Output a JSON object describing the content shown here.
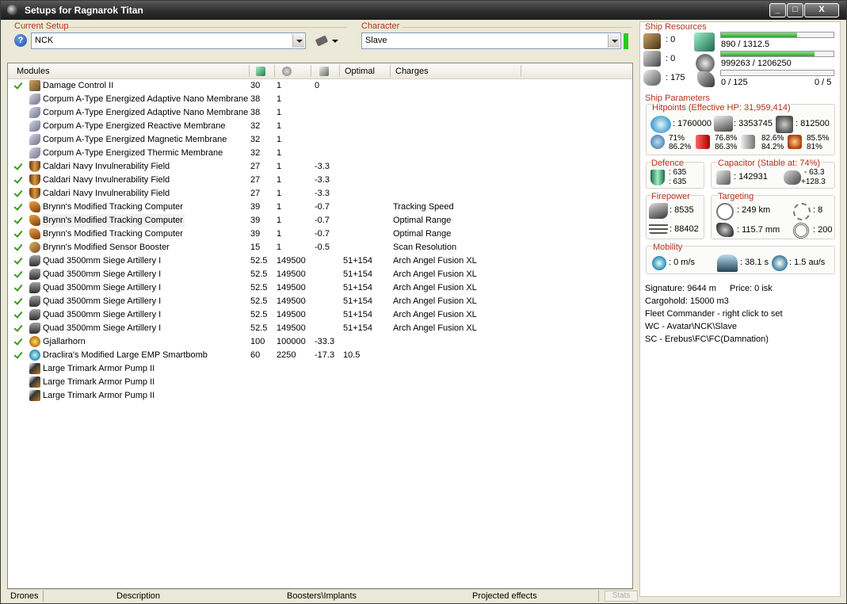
{
  "window": {
    "title": "Setups for Ragnarok Titan",
    "min_label": "_",
    "max_label": "□",
    "close_label": "X"
  },
  "setup": {
    "label": "Current Setup",
    "value": "NCK",
    "help_label": "?"
  },
  "character": {
    "label": "Character",
    "value": "Slave",
    "status_color": "#22cc22"
  },
  "modules": {
    "columns": [
      "Modules",
      "",
      "",
      "",
      "Optimal",
      "Charges"
    ],
    "column_icons": [
      "cpu-icon",
      "powergrid-icon",
      "cap-icon"
    ],
    "rows": [
      {
        "active": true,
        "icon": "damage-control-icon",
        "name": "Damage Control II",
        "c1": "30",
        "c2": "1",
        "c3": "0",
        "optimal": "",
        "charges": ""
      },
      {
        "active": false,
        "icon": "membrane-icon",
        "name": "Corpum A-Type Energized Adaptive Nano Membrane",
        "c1": "38",
        "c2": "1",
        "c3": "",
        "optimal": "",
        "charges": ""
      },
      {
        "active": false,
        "icon": "membrane-icon",
        "name": "Corpum A-Type Energized Adaptive Nano Membrane",
        "c1": "38",
        "c2": "1",
        "c3": "",
        "optimal": "",
        "charges": ""
      },
      {
        "active": false,
        "icon": "membrane-icon",
        "name": "Corpum A-Type Energized Reactive Membrane",
        "c1": "32",
        "c2": "1",
        "c3": "",
        "optimal": "",
        "charges": ""
      },
      {
        "active": false,
        "icon": "membrane-icon",
        "name": "Corpum A-Type Energized Magnetic Membrane",
        "c1": "32",
        "c2": "1",
        "c3": "",
        "optimal": "",
        "charges": ""
      },
      {
        "active": false,
        "icon": "membrane-icon",
        "name": "Corpum A-Type Energized Thermic Membrane",
        "c1": "32",
        "c2": "1",
        "c3": "",
        "optimal": "",
        "charges": ""
      },
      {
        "active": true,
        "icon": "invulnerability-icon",
        "name": "Caldari Navy Invulnerability Field",
        "c1": "27",
        "c2": "1",
        "c3": "-3.3",
        "optimal": "",
        "charges": ""
      },
      {
        "active": true,
        "icon": "invulnerability-icon",
        "name": "Caldari Navy Invulnerability Field",
        "c1": "27",
        "c2": "1",
        "c3": "-3.3",
        "optimal": "",
        "charges": ""
      },
      {
        "active": true,
        "icon": "invulnerability-icon",
        "name": "Caldari Navy Invulnerability Field",
        "c1": "27",
        "c2": "1",
        "c3": "-3.3",
        "optimal": "",
        "charges": ""
      },
      {
        "active": true,
        "icon": "tracking-computer-icon",
        "name": "Brynn's Modified Tracking Computer",
        "c1": "39",
        "c2": "1",
        "c3": "-0.7",
        "optimal": "",
        "charges": "Tracking Speed"
      },
      {
        "active": true,
        "icon": "tracking-computer-icon",
        "name": "Brynn's Modified Tracking Computer",
        "c1": "39",
        "c2": "1",
        "c3": "-0.7",
        "optimal": "",
        "charges": "Optimal Range",
        "highlight": true
      },
      {
        "active": true,
        "icon": "tracking-computer-icon",
        "name": "Brynn's Modified Tracking Computer",
        "c1": "39",
        "c2": "1",
        "c3": "-0.7",
        "optimal": "",
        "charges": "Optimal Range"
      },
      {
        "active": true,
        "icon": "sensor-booster-icon",
        "name": "Brynn's Modified Sensor Booster",
        "c1": "15",
        "c2": "1",
        "c3": "-0.5",
        "optimal": "",
        "charges": "Scan Resolution"
      },
      {
        "active": true,
        "icon": "artillery-icon",
        "name": "Quad 3500mm Siege Artillery I",
        "c1": "52.5",
        "c2": "149500",
        "c3": "",
        "optimal": "51+154",
        "charges": "Arch Angel Fusion XL"
      },
      {
        "active": true,
        "icon": "artillery-icon",
        "name": "Quad 3500mm Siege Artillery I",
        "c1": "52.5",
        "c2": "149500",
        "c3": "",
        "optimal": "51+154",
        "charges": "Arch Angel Fusion XL"
      },
      {
        "active": true,
        "icon": "artillery-icon",
        "name": "Quad 3500mm Siege Artillery I",
        "c1": "52.5",
        "c2": "149500",
        "c3": "",
        "optimal": "51+154",
        "charges": "Arch Angel Fusion XL"
      },
      {
        "active": true,
        "icon": "artillery-icon",
        "name": "Quad 3500mm Siege Artillery I",
        "c1": "52.5",
        "c2": "149500",
        "c3": "",
        "optimal": "51+154",
        "charges": "Arch Angel Fusion XL"
      },
      {
        "active": true,
        "icon": "artillery-icon",
        "name": "Quad 3500mm Siege Artillery I",
        "c1": "52.5",
        "c2": "149500",
        "c3": "",
        "optimal": "51+154",
        "charges": "Arch Angel Fusion XL"
      },
      {
        "active": true,
        "icon": "artillery-icon",
        "name": "Quad 3500mm Siege Artillery I",
        "c1": "52.5",
        "c2": "149500",
        "c3": "",
        "optimal": "51+154",
        "charges": "Arch Angel Fusion XL"
      },
      {
        "active": true,
        "icon": "doomsday-icon",
        "name": "Gjallarhorn",
        "c1": "100",
        "c2": "100000",
        "c3": "-33.3",
        "optimal": "",
        "charges": ""
      },
      {
        "active": true,
        "icon": "smartbomb-icon",
        "name": "Draclira's Modified Large EMP Smartbomb",
        "c1": "60",
        "c2": "2250",
        "c3": "-17.3",
        "optimal": "10.5",
        "charges": ""
      },
      {
        "active": false,
        "icon": "rig-icon",
        "name": "Large Trimark Armor Pump II",
        "c1": "",
        "c2": "",
        "c3": "",
        "optimal": "",
        "charges": ""
      },
      {
        "active": false,
        "icon": "rig-icon",
        "name": "Large Trimark Armor Pump II",
        "c1": "",
        "c2": "",
        "c3": "",
        "optimal": "",
        "charges": ""
      },
      {
        "active": false,
        "icon": "rig-icon",
        "name": "Large Trimark Armor Pump II",
        "c1": "",
        "c2": "",
        "c3": "",
        "optimal": "",
        "charges": ""
      }
    ]
  },
  "bottom_tabs": [
    "Drones",
    "Description",
    "Boosters\\Implants",
    "Projected effects",
    "Stats"
  ],
  "resources": {
    "label": "Ship Resources",
    "turret": ": 0",
    "launcher": ": 0",
    "calibration": ": 175",
    "cpu": "890 / 1312.5",
    "cpu_fraction": 0.678,
    "powergrid": "999263 / 1206250",
    "powergrid_fraction": 0.828,
    "drone_bay": "0 / 125",
    "drone_count": "0 / 5",
    "drone_fraction": 0
  },
  "params": {
    "label": "Ship Parameters",
    "hitpoints_label": "Hitpoints (Effective HP: 31,959,414)",
    "shield_hp": ": 1760000",
    "armor_hp": ": 3353745",
    "hull_hp": ": 812500",
    "em_top": "71%",
    "em_bottom": "86.2%",
    "therm_top": "76.8%",
    "therm_bottom": "86.3%",
    "kin_top": "82.6%",
    "kin_bottom": "84.2%",
    "exp_top": "85.5%",
    "exp_bottom": "81%",
    "defence_label": "Defence",
    "defence_top": ": 635",
    "defence_bottom": ": 635",
    "capacitor_label": "Capacitor (Stable at: 74%)",
    "cap_amount": ": 142931",
    "cap_delta_top": "- 63.3",
    "cap_delta_bottom": "+128.3",
    "firepower_label": "Firepower",
    "dps": ": 8535",
    "volley": ": 88402",
    "targeting_label": "Targeting",
    "target_range": ": 249 km",
    "max_targets": ": 8",
    "scan_res": ": 115.7 mm",
    "sensor_strength": ": 200",
    "mobility_label": "Mobility",
    "speed": ": 0 m/s",
    "align_time": ": 38.1 s",
    "warp_speed": ": 1.5 au/s",
    "signature": "Signature: 9644 m",
    "price": "Price: 0 isk",
    "cargohold": "Cargohold: 15000 m3",
    "fleet_commander": "Fleet Commander - right click to set",
    "wing_commander": "WC - Avatar\\NCK\\Slave",
    "squad_commander": "SC - Erebus\\FC\\FC(Damnation)"
  }
}
